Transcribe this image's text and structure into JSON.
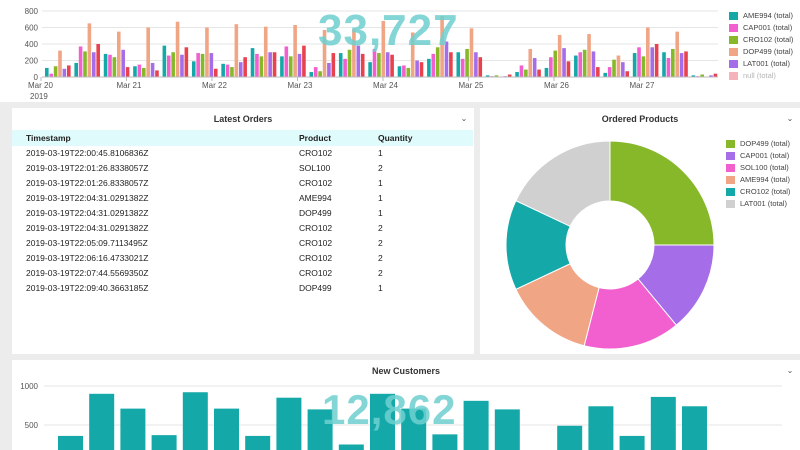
{
  "top_panel": {
    "big_number": "33,727",
    "y_ticks": [
      "800",
      "600",
      "400",
      "200",
      "0"
    ],
    "x_labels": [
      "Mar 20",
      "Mar 21",
      "Mar 22",
      "Mar 23",
      "Mar 24",
      "Mar 25",
      "Mar 26",
      "Mar 27"
    ],
    "x_sub_label": "2019",
    "legend": [
      {
        "label": "AME994 (total)",
        "color": "#14a8a8"
      },
      {
        "label": "CAP001 (total)",
        "color": "#f25fcf"
      },
      {
        "label": "CRO102 (total)",
        "color": "#86b82a"
      },
      {
        "label": "DOP499 (total)",
        "color": "#f0a585"
      },
      {
        "label": "LAT001 (total)",
        "color": "#a56ee8"
      },
      {
        "label": "null (total)",
        "color": "#e8424f"
      }
    ]
  },
  "orders_panel": {
    "title": "Latest Orders",
    "columns": [
      "Timestamp",
      "Product",
      "Quantity"
    ],
    "rows": [
      [
        "2019-03-19T22:00:45.8106836Z",
        "CRO102",
        "1"
      ],
      [
        "2019-03-19T22:01:26.8338057Z",
        "SOL100",
        "2"
      ],
      [
        "2019-03-19T22:01:26.8338057Z",
        "CRO102",
        "1"
      ],
      [
        "2019-03-19T22:04:31.0291382Z",
        "AME994",
        "1"
      ],
      [
        "2019-03-19T22:04:31.0291382Z",
        "DOP499",
        "1"
      ],
      [
        "2019-03-19T22:04:31.0291382Z",
        "CRO102",
        "2"
      ],
      [
        "2019-03-19T22:05:09.7113495Z",
        "CRO102",
        "2"
      ],
      [
        "2019-03-19T22:06:16.4733021Z",
        "CRO102",
        "2"
      ],
      [
        "2019-03-19T22:07:44.5569350Z",
        "CRO102",
        "2"
      ],
      [
        "2019-03-19T22:09:40.3663185Z",
        "DOP499",
        "1"
      ]
    ]
  },
  "products_panel": {
    "title": "Ordered Products",
    "legend": [
      {
        "label": "DOP499 (total)",
        "color": "#86b82a"
      },
      {
        "label": "CAP001 (total)",
        "color": "#a56ee8"
      },
      {
        "label": "SOL100 (total)",
        "color": "#f25fcf"
      },
      {
        "label": "AME994 (total)",
        "color": "#f0a585"
      },
      {
        "label": "CRO102 (total)",
        "color": "#14a8a8"
      },
      {
        "label": "LAT001 (total)",
        "color": "#d0d0d0"
      }
    ]
  },
  "customers_panel": {
    "title": "New Customers",
    "big_number": "12,862",
    "y_ticks": [
      "1000",
      "500"
    ]
  },
  "chart_data": [
    {
      "type": "bar",
      "ylim": [
        0,
        800
      ],
      "series_names": [
        "AME994",
        "CAP001",
        "CRO102",
        "DOP499",
        "LAT001",
        "null"
      ],
      "colors": [
        "#14a8a8",
        "#f25fcf",
        "#86b82a",
        "#f0a585",
        "#a56ee8",
        "#e8424f"
      ],
      "groups": [
        [
          110,
          40,
          130,
          320,
          100,
          140
        ],
        [
          170,
          370,
          310,
          650,
          300,
          400
        ],
        [
          280,
          270,
          240,
          550,
          330,
          120
        ],
        [
          130,
          150,
          110,
          600,
          170,
          80
        ],
        [
          380,
          260,
          300,
          670,
          270,
          360
        ],
        [
          190,
          290,
          280,
          600,
          290,
          100
        ],
        [
          160,
          150,
          120,
          640,
          180,
          240
        ],
        [
          350,
          280,
          250,
          610,
          300,
          300
        ],
        [
          250,
          370,
          250,
          630,
          280,
          380
        ],
        [
          60,
          120,
          70,
          570,
          170,
          290
        ],
        [
          290,
          220,
          330,
          580,
          380,
          280
        ],
        [
          180,
          340,
          290,
          680,
          300,
          270
        ],
        [
          130,
          140,
          110,
          540,
          200,
          180
        ],
        [
          220,
          280,
          360,
          740,
          430,
          300
        ],
        [
          300,
          220,
          340,
          590,
          300,
          240
        ],
        [
          20,
          10,
          20,
          0,
          10,
          30
        ],
        [
          60,
          140,
          90,
          340,
          230,
          90
        ],
        [
          110,
          240,
          320,
          510,
          350,
          190
        ],
        [
          260,
          300,
          330,
          520,
          310,
          120
        ],
        [
          50,
          120,
          210,
          260,
          180,
          70
        ],
        [
          290,
          360,
          250,
          600,
          360,
          400
        ],
        [
          300,
          230,
          340,
          550,
          290,
          310
        ],
        [
          20,
          10,
          30,
          0,
          20,
          40
        ]
      ]
    },
    {
      "type": "pie",
      "labels": [
        "DOP499",
        "CAP001",
        "SOL100",
        "AME994",
        "CRO102",
        "LAT001"
      ],
      "values": [
        25,
        14,
        15,
        14,
        14,
        18
      ]
    },
    {
      "type": "bar",
      "ylim": [
        0,
        1000
      ],
      "values": [
        360,
        900,
        710,
        370,
        920,
        710,
        360,
        850,
        700,
        250,
        900,
        710,
        380,
        810,
        700,
        0,
        490,
        740,
        360,
        860,
        740
      ]
    }
  ]
}
